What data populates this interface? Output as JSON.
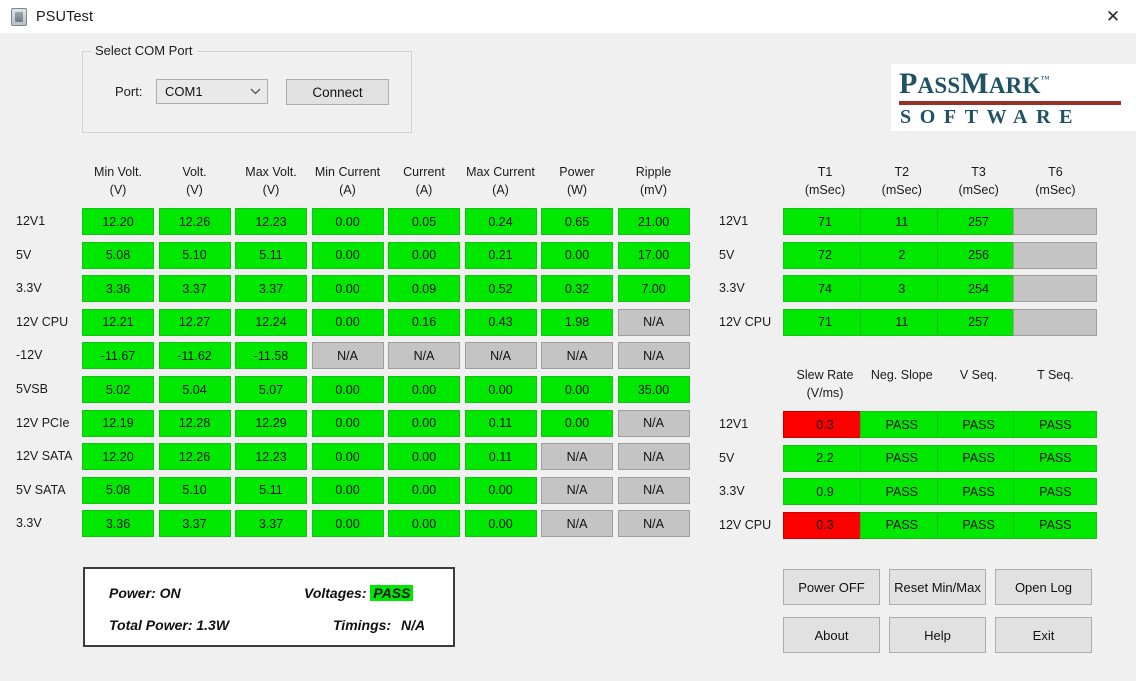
{
  "window": {
    "title": "PSUTest",
    "app_icon": "psu-device-icon",
    "close_label": "✕"
  },
  "com_port": {
    "group_title": "Select COM Port",
    "port_label": "Port:",
    "port_value": "COM1",
    "port_options": [
      "COM1"
    ],
    "dropdown_icon": "chevron-down-icon",
    "connect_label": "Connect"
  },
  "logo": {
    "pass": "P",
    "ass": "ASS",
    "m": "M",
    "ark": "ARK",
    "tm": "™",
    "subtitle": "SOFTWARE",
    "text_color": "#1f5264",
    "bar_color": "#973127"
  },
  "colors": {
    "pass_green": "#00e800",
    "fail_red": "#fc0000",
    "na_gray": "#c4c4c4",
    "window_bg": "#f0f0f0"
  },
  "voltage_table": {
    "headers": [
      {
        "line1": "Min Volt.",
        "line2": "(V)"
      },
      {
        "line1": "Volt.",
        "line2": "(V)"
      },
      {
        "line1": "Max Volt.",
        "line2": "(V)"
      },
      {
        "line1": "Min Current",
        "line2": "(A)"
      },
      {
        "line1": "Current",
        "line2": "(A)"
      },
      {
        "line1": "Max Current",
        "line2": "(A)"
      },
      {
        "line1": "Power",
        "line2": "(W)"
      },
      {
        "line1": "Ripple",
        "line2": "(mV)"
      }
    ],
    "rows": [
      {
        "label": "12V1",
        "cells": [
          {
            "v": "12.20",
            "s": "green"
          },
          {
            "v": "12.26",
            "s": "green"
          },
          {
            "v": "12.23",
            "s": "green"
          },
          {
            "v": "0.00",
            "s": "green"
          },
          {
            "v": "0.05",
            "s": "green"
          },
          {
            "v": "0.24",
            "s": "green"
          },
          {
            "v": "0.65",
            "s": "green"
          },
          {
            "v": "21.00",
            "s": "green"
          }
        ]
      },
      {
        "label": "5V",
        "cells": [
          {
            "v": "5.08",
            "s": "green"
          },
          {
            "v": "5.10",
            "s": "green"
          },
          {
            "v": "5.11",
            "s": "green"
          },
          {
            "v": "0.00",
            "s": "green"
          },
          {
            "v": "0.00",
            "s": "green"
          },
          {
            "v": "0.21",
            "s": "green"
          },
          {
            "v": "0.00",
            "s": "green"
          },
          {
            "v": "17.00",
            "s": "green"
          }
        ]
      },
      {
        "label": "3.3V",
        "cells": [
          {
            "v": "3.36",
            "s": "green"
          },
          {
            "v": "3.37",
            "s": "green"
          },
          {
            "v": "3.37",
            "s": "green"
          },
          {
            "v": "0.00",
            "s": "green"
          },
          {
            "v": "0.09",
            "s": "green"
          },
          {
            "v": "0.52",
            "s": "green"
          },
          {
            "v": "0.32",
            "s": "green"
          },
          {
            "v": "7.00",
            "s": "green"
          }
        ]
      },
      {
        "label": "12V CPU",
        "cells": [
          {
            "v": "12.21",
            "s": "green"
          },
          {
            "v": "12.27",
            "s": "green"
          },
          {
            "v": "12.24",
            "s": "green"
          },
          {
            "v": "0.00",
            "s": "green"
          },
          {
            "v": "0.16",
            "s": "green"
          },
          {
            "v": "0.43",
            "s": "green"
          },
          {
            "v": "1.98",
            "s": "green"
          },
          {
            "v": "N/A",
            "s": "gray"
          }
        ]
      },
      {
        "label": "-12V",
        "cells": [
          {
            "v": "-11.67",
            "s": "green"
          },
          {
            "v": "-11.62",
            "s": "green"
          },
          {
            "v": "-11.58",
            "s": "green"
          },
          {
            "v": "N/A",
            "s": "gray"
          },
          {
            "v": "N/A",
            "s": "gray"
          },
          {
            "v": "N/A",
            "s": "gray"
          },
          {
            "v": "N/A",
            "s": "gray"
          },
          {
            "v": "N/A",
            "s": "gray"
          }
        ]
      },
      {
        "label": "5VSB",
        "cells": [
          {
            "v": "5.02",
            "s": "green"
          },
          {
            "v": "5.04",
            "s": "green"
          },
          {
            "v": "5.07",
            "s": "green"
          },
          {
            "v": "0.00",
            "s": "green"
          },
          {
            "v": "0.00",
            "s": "green"
          },
          {
            "v": "0.00",
            "s": "green"
          },
          {
            "v": "0.00",
            "s": "green"
          },
          {
            "v": "35.00",
            "s": "green"
          }
        ]
      },
      {
        "label": "12V PCIe",
        "cells": [
          {
            "v": "12.19",
            "s": "green"
          },
          {
            "v": "12.28",
            "s": "green"
          },
          {
            "v": "12.29",
            "s": "green"
          },
          {
            "v": "0.00",
            "s": "green"
          },
          {
            "v": "0.00",
            "s": "green"
          },
          {
            "v": "0.11",
            "s": "green"
          },
          {
            "v": "0.00",
            "s": "green"
          },
          {
            "v": "N/A",
            "s": "gray"
          }
        ]
      },
      {
        "label": "12V SATA",
        "cells": [
          {
            "v": "12.20",
            "s": "green"
          },
          {
            "v": "12.26",
            "s": "green"
          },
          {
            "v": "12.23",
            "s": "green"
          },
          {
            "v": "0.00",
            "s": "green"
          },
          {
            "v": "0.00",
            "s": "green"
          },
          {
            "v": "0.11",
            "s": "green"
          },
          {
            "v": "N/A",
            "s": "gray"
          },
          {
            "v": "N/A",
            "s": "gray"
          }
        ]
      },
      {
        "label": "5V SATA",
        "cells": [
          {
            "v": "5.08",
            "s": "green"
          },
          {
            "v": "5.10",
            "s": "green"
          },
          {
            "v": "5.11",
            "s": "green"
          },
          {
            "v": "0.00",
            "s": "green"
          },
          {
            "v": "0.00",
            "s": "green"
          },
          {
            "v": "0.00",
            "s": "green"
          },
          {
            "v": "N/A",
            "s": "gray"
          },
          {
            "v": "N/A",
            "s": "gray"
          }
        ]
      },
      {
        "label": "3.3V",
        "cells": [
          {
            "v": "3.36",
            "s": "green"
          },
          {
            "v": "3.37",
            "s": "green"
          },
          {
            "v": "3.37",
            "s": "green"
          },
          {
            "v": "0.00",
            "s": "green"
          },
          {
            "v": "0.00",
            "s": "green"
          },
          {
            "v": "0.00",
            "s": "green"
          },
          {
            "v": "N/A",
            "s": "gray"
          },
          {
            "v": "N/A",
            "s": "gray"
          }
        ]
      }
    ]
  },
  "timing_table": {
    "headers": [
      {
        "line1": "T1",
        "line2": "(mSec)"
      },
      {
        "line1": "T2",
        "line2": "(mSec)"
      },
      {
        "line1": "T3",
        "line2": "(mSec)"
      },
      {
        "line1": "T6",
        "line2": "(mSec)"
      }
    ],
    "rows": [
      {
        "label": "12V1",
        "cells": [
          {
            "v": "71",
            "s": "green"
          },
          {
            "v": "11",
            "s": "green"
          },
          {
            "v": "257",
            "s": "green"
          },
          {
            "v": "",
            "s": "gray"
          }
        ]
      },
      {
        "label": "5V",
        "cells": [
          {
            "v": "72",
            "s": "green"
          },
          {
            "v": "2",
            "s": "green"
          },
          {
            "v": "256",
            "s": "green"
          },
          {
            "v": "",
            "s": "gray"
          }
        ]
      },
      {
        "label": "3.3V",
        "cells": [
          {
            "v": "74",
            "s": "green"
          },
          {
            "v": "3",
            "s": "green"
          },
          {
            "v": "254",
            "s": "green"
          },
          {
            "v": "",
            "s": "gray"
          }
        ]
      },
      {
        "label": "12V CPU",
        "cells": [
          {
            "v": "71",
            "s": "green"
          },
          {
            "v": "11",
            "s": "green"
          },
          {
            "v": "257",
            "s": "green"
          },
          {
            "v": "",
            "s": "gray"
          }
        ]
      }
    ]
  },
  "slew_table": {
    "headers": [
      {
        "line1": "Slew Rate",
        "line2": "(V/ms)"
      },
      {
        "line1": "Neg. Slope",
        "line2": ""
      },
      {
        "line1": "V Seq.",
        "line2": ""
      },
      {
        "line1": "T Seq.",
        "line2": ""
      }
    ],
    "rows": [
      {
        "label": "12V1",
        "cells": [
          {
            "v": "0.3",
            "s": "red"
          },
          {
            "v": "PASS",
            "s": "green"
          },
          {
            "v": "PASS",
            "s": "green"
          },
          {
            "v": "PASS",
            "s": "green"
          }
        ]
      },
      {
        "label": "5V",
        "cells": [
          {
            "v": "2.2",
            "s": "green"
          },
          {
            "v": "PASS",
            "s": "green"
          },
          {
            "v": "PASS",
            "s": "green"
          },
          {
            "v": "PASS",
            "s": "green"
          }
        ]
      },
      {
        "label": "3.3V",
        "cells": [
          {
            "v": "0.9",
            "s": "green"
          },
          {
            "v": "PASS",
            "s": "green"
          },
          {
            "v": "PASS",
            "s": "green"
          },
          {
            "v": "PASS",
            "s": "green"
          }
        ]
      },
      {
        "label": "12V CPU",
        "cells": [
          {
            "v": "0.3",
            "s": "red"
          },
          {
            "v": "PASS",
            "s": "green"
          },
          {
            "v": "PASS",
            "s": "green"
          },
          {
            "v": "PASS",
            "s": "green"
          }
        ]
      }
    ]
  },
  "status": {
    "power_label": "Power: ON",
    "voltages_label": "Voltages:",
    "voltages_value": "PASS",
    "total_power_label": "Total Power: 1.3W",
    "timings_label": "Timings:",
    "timings_value": "N/A"
  },
  "actions": {
    "power_off": "Power OFF",
    "reset_minmax": "Reset Min/Max",
    "open_log": "Open Log",
    "about": "About",
    "help": "Help",
    "exit": "Exit"
  }
}
